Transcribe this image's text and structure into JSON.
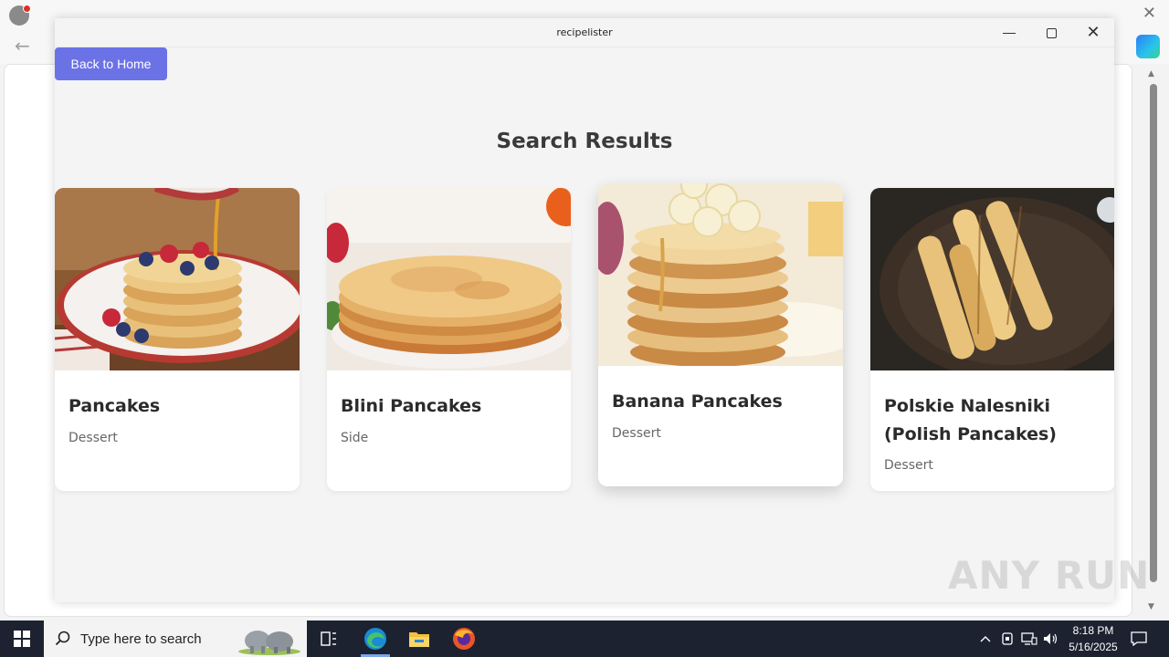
{
  "app": {
    "title": "recipelister",
    "back_button": "Back to Home",
    "heading": "Search Results"
  },
  "cards": [
    {
      "title": "Pancakes",
      "category": "Dessert"
    },
    {
      "title": "Blini Pancakes",
      "category": "Side"
    },
    {
      "title": "Banana Pancakes",
      "category": "Dessert"
    },
    {
      "title": "Polskie Nalesniki (Polish Pancakes)",
      "category": "Dessert"
    }
  ],
  "watermark": "ANY RUN",
  "taskbar": {
    "search_placeholder": "Type here to search",
    "time": "8:18 PM",
    "date": "5/16/2025"
  },
  "colors": {
    "accent": "#6b72e6",
    "app_background": "#f4f4f4",
    "taskbar": "#1c2230"
  }
}
